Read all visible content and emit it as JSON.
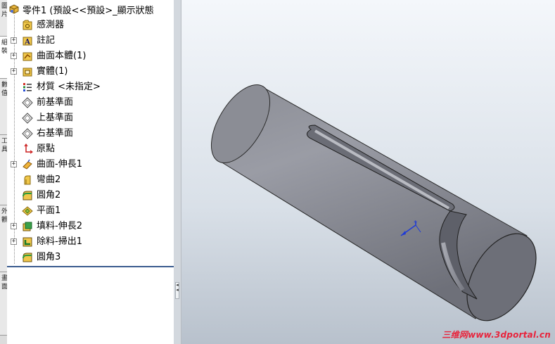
{
  "side_tabs": [
    "圖",
    "片",
    "組",
    "裝",
    "數",
    "值",
    "工",
    "具",
    "外",
    "觀",
    "畫",
    "面"
  ],
  "tree": {
    "root_label": "零件1 (預設<<預設>_顯示狀態",
    "items": [
      {
        "label": "感測器",
        "icon": "sensor-icon",
        "expandable": false
      },
      {
        "label": "註記",
        "icon": "annotation-icon",
        "expandable": true
      },
      {
        "label": "曲面本體(1)",
        "icon": "surface-bodies-folder-icon",
        "expandable": true
      },
      {
        "label": "實體(1)",
        "icon": "solid-bodies-folder-icon",
        "expandable": true
      },
      {
        "label": "材質 <未指定>",
        "icon": "material-icon",
        "expandable": false
      },
      {
        "label": "前基準面",
        "icon": "plane-icon",
        "expandable": false
      },
      {
        "label": "上基準面",
        "icon": "plane-icon",
        "expandable": false
      },
      {
        "label": "右基準面",
        "icon": "plane-icon",
        "expandable": false
      },
      {
        "label": "原點",
        "icon": "origin-icon",
        "expandable": false
      },
      {
        "label": "曲面-伸長1",
        "icon": "surface-extrude-icon",
        "expandable": true
      },
      {
        "label": "彎曲2",
        "icon": "flex-icon",
        "expandable": false
      },
      {
        "label": "圓角2",
        "icon": "fillet-icon",
        "expandable": false
      },
      {
        "label": "平面1",
        "icon": "planar-surface-icon",
        "expandable": false
      },
      {
        "label": "填料-伸長2",
        "icon": "boss-extrude-icon",
        "expandable": true
      },
      {
        "label": "除料-掃出1",
        "icon": "cut-sweep-icon",
        "expandable": true
      },
      {
        "label": "圓角3",
        "icon": "fillet-icon",
        "expandable": false
      }
    ]
  },
  "viewport": {
    "model": "cylinder-with-slot-model",
    "watermark": "三维网www.3dportal.cn",
    "colors": {
      "model": "#8e9099",
      "watermark": "#e8243c",
      "triad": "#1f3bd6"
    }
  }
}
